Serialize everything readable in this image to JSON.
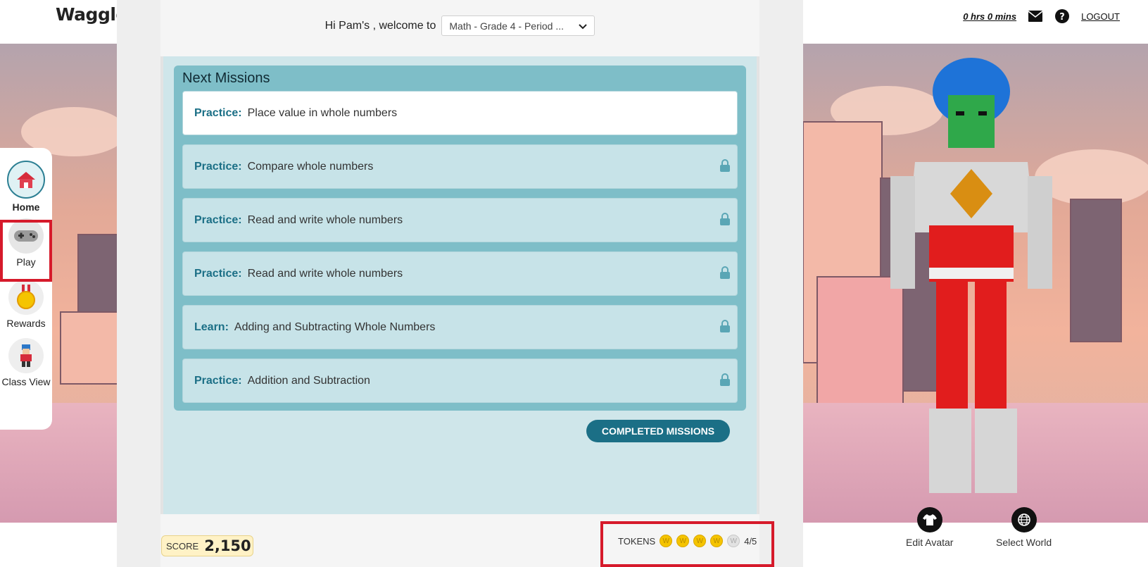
{
  "header": {
    "logo": "Waggle",
    "welcome_text": "Hi Pam's , welcome to",
    "class_select": "Math - Grade 4 - Period ...",
    "time": "0 hrs 0 mins",
    "logout": "LOGOUT"
  },
  "missions": {
    "title": "Next Missions",
    "items": [
      {
        "type": "Practice:",
        "title": "Place value in whole numbers",
        "locked": false
      },
      {
        "type": "Practice:",
        "title": "Compare whole numbers",
        "locked": true
      },
      {
        "type": "Practice:",
        "title": "Read and write whole numbers",
        "locked": true
      },
      {
        "type": "Practice:",
        "title": "Read and write whole numbers",
        "locked": true
      },
      {
        "type": "Learn:",
        "title": "Adding and Subtracting Whole Numbers",
        "locked": true
      },
      {
        "type": "Practice:",
        "title": "Addition and Subtraction",
        "locked": true
      }
    ],
    "completed_button": "COMPLETED MISSIONS"
  },
  "nav": {
    "items": [
      {
        "label": "Home",
        "icon": "home-icon"
      },
      {
        "label": "Play",
        "icon": "gamepad-icon"
      },
      {
        "label": "Rewards",
        "icon": "medal-icon"
      },
      {
        "label": "Class View",
        "icon": "class-avatar-icon"
      }
    ]
  },
  "bottom": {
    "score_label": "SCORE",
    "score_value": "2,150",
    "tokens_label": "TOKENS",
    "tokens_filled": 4,
    "tokens_total": 5,
    "tokens_count": "4/5",
    "edit_avatar": "Edit Avatar",
    "select_world": "Select World"
  },
  "colors": {
    "accent": "#1b6f86",
    "panel": "#7ebec8",
    "highlight": "#d61a2b"
  }
}
